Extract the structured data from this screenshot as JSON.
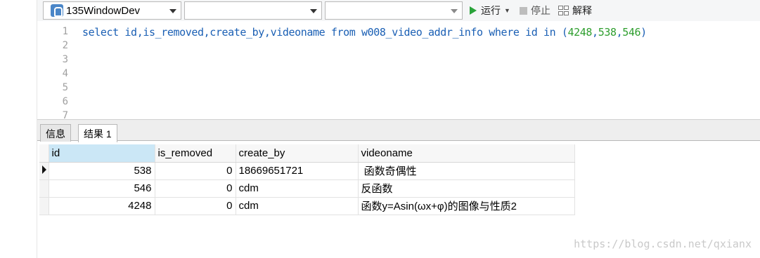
{
  "toolbar": {
    "connection_value": "135WindowDev",
    "database_value": "",
    "schema_value": "",
    "run_label": "运行",
    "stop_label": "停止",
    "explain_label": "解释"
  },
  "editor": {
    "line_numbers": [
      "1",
      "2",
      "3",
      "4",
      "5",
      "6",
      "7"
    ],
    "query": {
      "kw_select": "select",
      "columns": " id,is_removed,create_by,videoname ",
      "kw_from": "from",
      "table": " w008_video_addr_info ",
      "kw_where": "where",
      "col_id": " id ",
      "kw_in": "in",
      "open_paren": " (",
      "n1": "4248",
      "comma1": ",",
      "n2": "538",
      "comma2": ",",
      "n3": "546",
      "close_paren": ")"
    }
  },
  "tabs": [
    {
      "label": "信息"
    },
    {
      "label": "结果 1"
    }
  ],
  "results": {
    "columns": [
      "id",
      "is_removed",
      "create_by",
      "videoname"
    ],
    "rows": [
      [
        "538",
        "0",
        "18669651721",
        " 函数奇偶性"
      ],
      [
        "546",
        "0",
        "cdm",
        "反函数"
      ],
      [
        "4248",
        "0",
        "cdm",
        "函数y=Asin(ωx+φ)的图像与性质2"
      ]
    ]
  },
  "watermark": "https://blog.csdn.net/qxianx",
  "colors": {
    "keyword": "#1a5fb4",
    "number": "#2e9e2e",
    "sorted_header": "#cbe7f6",
    "run_icon": "#2aa33a"
  }
}
